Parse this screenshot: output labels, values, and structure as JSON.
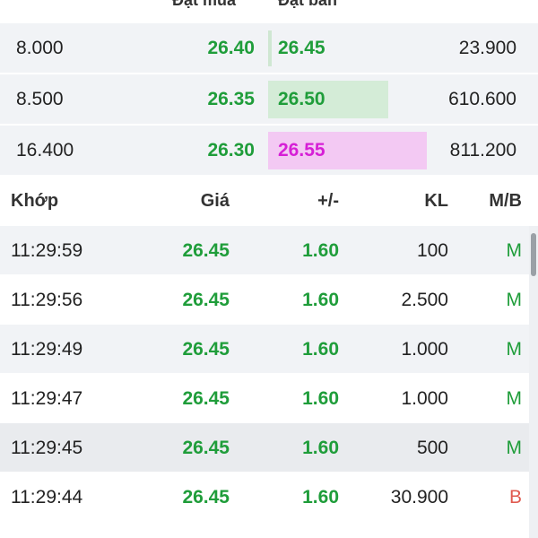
{
  "orderbook": {
    "headers": {
      "buy": "Đặt mua",
      "sell": "Đặt bán"
    },
    "rows": [
      {
        "bid_vol": "8.000",
        "bid_price": "26.40",
        "ask_price": "26.45",
        "ask_vol": "23.900",
        "ask_bar_color": "none"
      },
      {
        "bid_vol": "8.500",
        "bid_price": "26.35",
        "ask_price": "26.50",
        "ask_vol": "610.600",
        "ask_bar_color": "#d4ecd7"
      },
      {
        "bid_vol": "16.400",
        "bid_price": "26.30",
        "ask_price": "26.55",
        "ask_vol": "811.200",
        "ask_bar_color": "#f3c9f3"
      }
    ]
  },
  "matches": {
    "headers": {
      "time": "Khớp",
      "price": "Giá",
      "change": "+/-",
      "volume": "KL",
      "side": "M/B"
    },
    "rows": [
      {
        "time": "11:29:59",
        "price": "26.45",
        "change": "1.60",
        "volume": "100",
        "side": "M"
      },
      {
        "time": "11:29:56",
        "price": "26.45",
        "change": "1.60",
        "volume": "2.500",
        "side": "M"
      },
      {
        "time": "11:29:49",
        "price": "26.45",
        "change": "1.60",
        "volume": "1.000",
        "side": "M"
      },
      {
        "time": "11:29:47",
        "price": "26.45",
        "change": "1.60",
        "volume": "1.000",
        "side": "M"
      },
      {
        "time": "11:29:45",
        "price": "26.45",
        "change": "1.60",
        "volume": "500",
        "side": "M"
      },
      {
        "time": "11:29:44",
        "price": "26.45",
        "change": "1.60",
        "volume": "30.900",
        "side": "B"
      }
    ]
  },
  "colors": {
    "up_green": "#1f9d3a",
    "sell_red": "#e05a4f",
    "ceiling_magenta": "#d61fd6",
    "row_bg": "#f1f3f6",
    "row_bg_highlight": "#e9ebee"
  }
}
